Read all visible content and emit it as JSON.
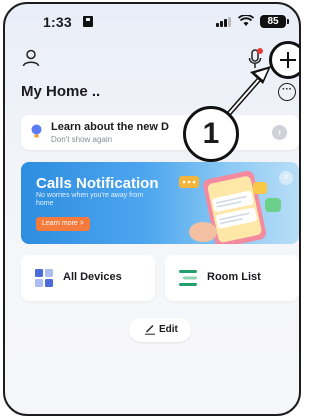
{
  "status_bar": {
    "time": "1:33",
    "battery": "85"
  },
  "header": {
    "home_title": "My Home .."
  },
  "tip_banner": {
    "title": "Learn about the new D",
    "subtitle": "Don't show again"
  },
  "promo": {
    "title": "Calls Notification",
    "description": "No worries when you're away from home",
    "button_label": "Learn more >"
  },
  "tiles": {
    "devices_label": "All Devices",
    "rooms_label": "Room List"
  },
  "edit_label": "Edit",
  "annotation": {
    "number": "1"
  },
  "colors": {
    "accent_orange": "#f47b3b",
    "promo_blue": "#2e8de0",
    "green_icon": "#22a06b",
    "bulb_blue": "#5b7cf5"
  }
}
